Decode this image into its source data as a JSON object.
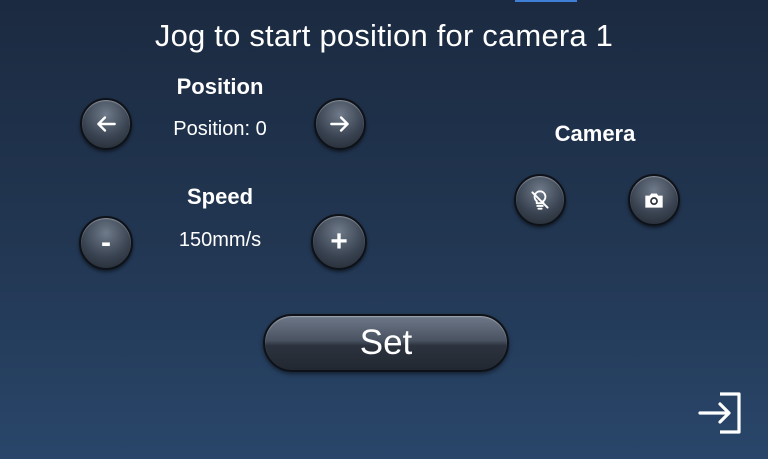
{
  "title": "Jog to start position for camera 1",
  "position": {
    "label": "Position",
    "value": "Position: 0",
    "left_icon": "arrow-left-icon",
    "right_icon": "arrow-right-icon"
  },
  "speed": {
    "label": "Speed",
    "value": "150mm/s",
    "decrease_label": "-",
    "increase_label": "+"
  },
  "camera": {
    "label": "Camera",
    "light_icon": "light-off-icon",
    "capture_icon": "camera-icon"
  },
  "set_button": {
    "label": "Set"
  },
  "exit_icon": "exit-icon",
  "colors": {
    "accent": "#3f7fd6",
    "background_top": "#1b2a40",
    "background_bottom": "#29466a"
  }
}
